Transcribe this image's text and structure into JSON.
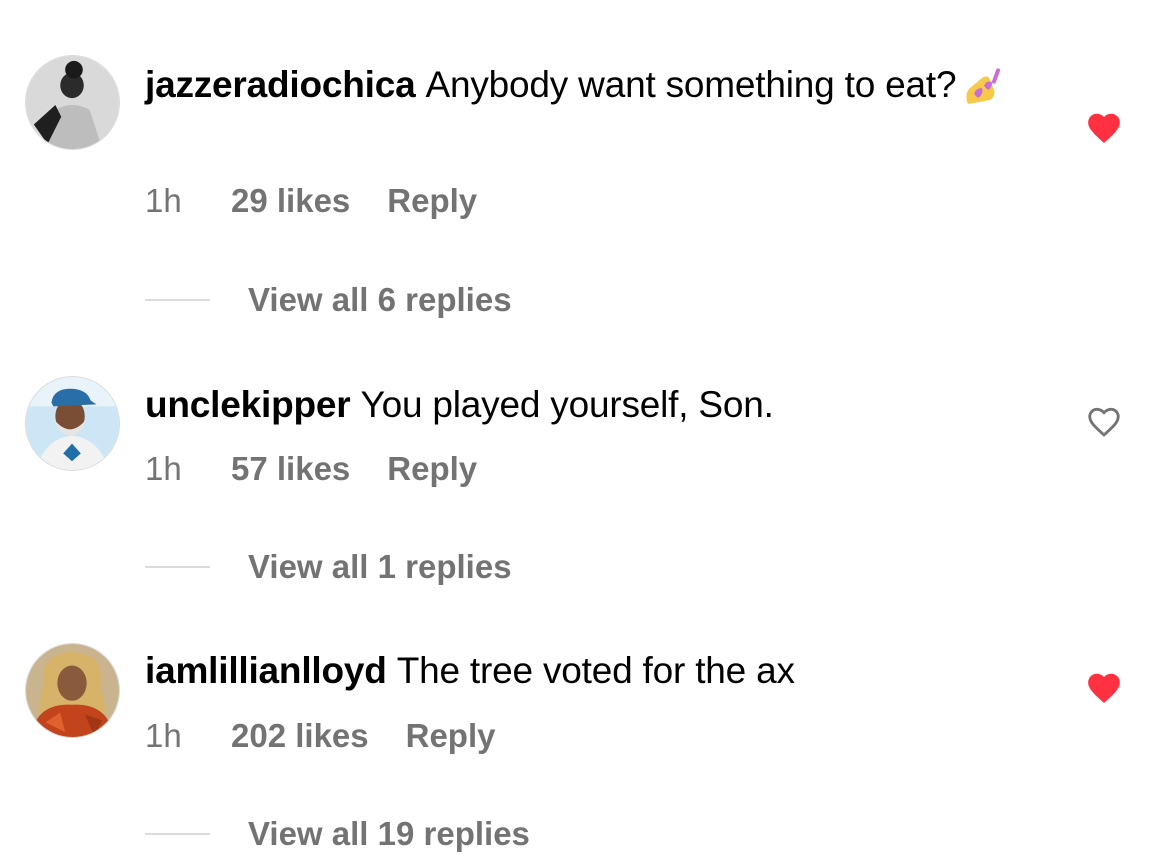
{
  "colors": {
    "liked": "#ff3040",
    "unliked_stroke": "#737373",
    "meta": "#737373"
  },
  "comments": [
    {
      "username": "jazzeradiochica",
      "text": "Anybody want something to eat?",
      "emoji": "nail-polish-emoji",
      "time": "1h",
      "likes": "29 likes",
      "reply": "Reply",
      "view_replies": "View all 6 replies",
      "liked": true
    },
    {
      "username": "unclekipper",
      "text": "You played yourself, Son.",
      "time": "1h",
      "likes": "57 likes",
      "reply": "Reply",
      "view_replies": "View all 1 replies",
      "liked": false
    },
    {
      "username": "iamlillianlloyd",
      "text": "The tree voted for the ax",
      "time": "1h",
      "likes": "202 likes",
      "reply": "Reply",
      "view_replies": "View all 19 replies",
      "liked": true
    }
  ]
}
